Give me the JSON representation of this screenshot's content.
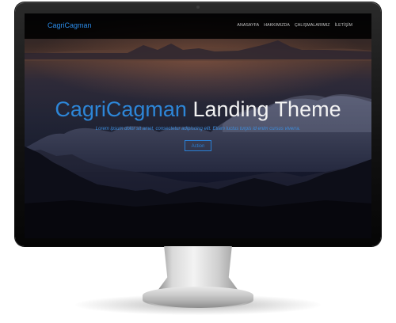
{
  "site": {
    "brand": "CagriCagman",
    "nav": [
      "ANASAYFA",
      "HAKKIMIZDA",
      "ÇALIŞMALARIMIZ",
      "İLETİŞİM"
    ]
  },
  "hero": {
    "title_brand": "CagriCagman",
    "title_rest": " Landing Theme",
    "subtitle": "Lorem ipsum dolor sit amet, consectetur adipiscing elit. Etiam luctus turpis id enim cursus viverra.",
    "button": "Action"
  },
  "colors": {
    "accent": "#2b8be8",
    "navbar": "#000000",
    "hero_text": "#f2f2f2"
  }
}
